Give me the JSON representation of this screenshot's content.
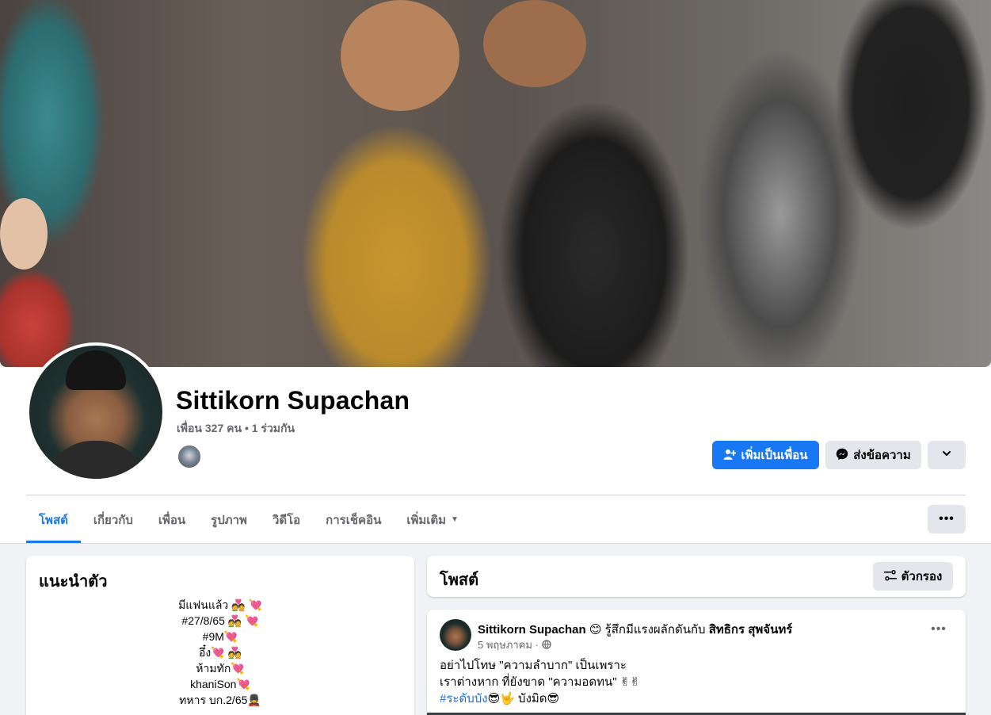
{
  "profile": {
    "name": "Sittikorn Supachan",
    "friends_line": "เพื่อน 327 คน • 1 ร่วมกัน"
  },
  "actions": {
    "add_friend": "เพิ่มเป็นเพื่อน",
    "message": "ส่งข้อความ"
  },
  "tabs": [
    {
      "label": "โพสต์",
      "active": true
    },
    {
      "label": "เกี่ยวกับ"
    },
    {
      "label": "เพื่อน"
    },
    {
      "label": "รูปภาพ"
    },
    {
      "label": "วิดีโอ"
    },
    {
      "label": "การเช็คอิน"
    },
    {
      "label": "เพิ่มเติม"
    }
  ],
  "intro": {
    "title": "แนะนำตัว",
    "bio": [
      "มีแฟนแล้ว 💑 💘",
      "#27/8/65 💑 💘",
      "#9M💘",
      "อึ๋ง💘 💑",
      "ห้ามทัก💘",
      "khaniSon💘",
      "ทหาร บก.2/65💂"
    ]
  },
  "posts_section": {
    "title": "โพสต์",
    "filter_label": "ตัวกรอง"
  },
  "post": {
    "author": "Sittikorn Supachan",
    "feeling": "😊 รู้สึกมีแรงผลักดันกับ",
    "tagged": "สิทธิกร สุพจันทร์",
    "date": "5 พฤษภาคม",
    "body_lines": [
      "อย่าไปโทษ \"ความลำบาก\" เป็นเพราะ",
      "เราต่างหาก ที่ยังขาด \"ความอดทน\" ✌✌"
    ],
    "hashtag": "#ระดับบัง",
    "hashtag_tail": "😎🤟 บังมิด😎"
  },
  "icons": {
    "add_friend": "person-plus-icon",
    "message": "messenger-icon",
    "chevron": "chevron-down-icon",
    "more": "more-dots-icon",
    "filter": "filter-icon",
    "privacy": "globe-icon"
  },
  "colors": {
    "accent": "#1877f2",
    "background": "#f0f2f5",
    "secondary_button": "#e4e6eb",
    "muted_text": "#65676b"
  }
}
